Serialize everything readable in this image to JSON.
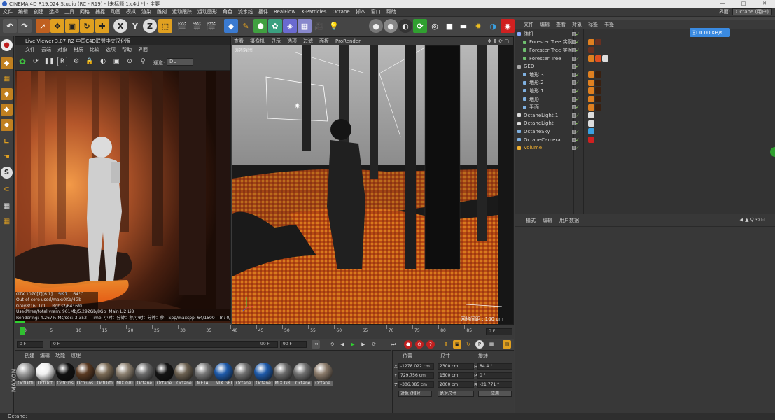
{
  "window": {
    "title": "CINEMA 4D R19.024 Studio (RC - R19) - [未标题 1.c4d *] - 主要"
  },
  "menubar": {
    "items": [
      "文件",
      "编辑",
      "创建",
      "选择",
      "工具",
      "网格",
      "捕捉",
      "动画",
      "模拟",
      "渲染",
      "雕刻",
      "运动跟踪",
      "运动图形",
      "角色",
      "流水线",
      "插件",
      "RealFlow",
      "X-Particles",
      "Octane",
      "脚本",
      "窗口",
      "帮助"
    ],
    "layout_label": "界面:",
    "layout_value": "Octane (用户)"
  },
  "live_viewer": {
    "title": "Live Viewer 3.07-R2 中国C4D联盟中文汉化版",
    "menu": [
      "文件",
      "云端",
      "对象",
      "材质",
      "比较",
      "选项",
      "帮助",
      "界面"
    ],
    "channel_label": "通道:",
    "channel_value": "DL",
    "stats": {
      "gpu": "GTX 1070[T][6.1]",
      "gpu_load": "%97",
      "gpu_temp": "64°C",
      "out_of_core": "Out-of-core used/max:0Kb/4Gb",
      "grey": "Grey8/16: 1/0",
      "rgb": "Rgb32/64: 6/0",
      "vram": "Used/free/total vram: 961Mb/5.292Gb/8Gb",
      "vram_tabs": "Main  Li2  Li8",
      "rendering": "Rendering: 4.267% Ms/sec: 3.352",
      "time": "Time: 小时：分钟：秒/小时：分钟：秒",
      "spp": "Spp/maxspp: 64/1500",
      "tri": "Tri: 0/2.668t"
    }
  },
  "viewport": {
    "menu": [
      "查看",
      "摄像机",
      "显示",
      "选项",
      "过滤",
      "面板",
      "ProRender"
    ],
    "label": "透视视图",
    "grid_spacing": "网格间距 : 100 cm"
  },
  "object_manager": {
    "menu": [
      "文件",
      "编辑",
      "查看",
      "对象",
      "标签",
      "书签"
    ],
    "network_speed": "0.00 KB/s",
    "objects": [
      {
        "name": "随机",
        "indent": 0,
        "color": "#88aaff"
      },
      {
        "name": "Forester Tree 实例.1",
        "indent": 1,
        "color": "#6fbf6f"
      },
      {
        "name": "Forester Tree 实例",
        "indent": 1,
        "color": "#6fbf6f"
      },
      {
        "name": "Forester Tree",
        "indent": 1,
        "color": "#6fbf6f"
      },
      {
        "name": "GEO",
        "indent": 0,
        "color": "#aaaaaa"
      },
      {
        "name": "地形.3",
        "indent": 1,
        "color": "#7fb0e0"
      },
      {
        "name": "地形.2",
        "indent": 1,
        "color": "#7fb0e0"
      },
      {
        "name": "地形.1",
        "indent": 1,
        "color": "#7fb0e0"
      },
      {
        "name": "地形",
        "indent": 1,
        "color": "#7fb0e0"
      },
      {
        "name": "平面",
        "indent": 1,
        "color": "#7fb0e0"
      },
      {
        "name": "OctaneLight.1",
        "indent": 0,
        "color": "#dddddd"
      },
      {
        "name": "OctaneLight",
        "indent": 0,
        "color": "#dddddd"
      },
      {
        "name": "OctaneSky",
        "indent": 0,
        "color": "#7fb0e0"
      },
      {
        "name": "OctaneCamera",
        "indent": 0,
        "color": "#7fb0e0"
      },
      {
        "name": "Volume",
        "indent": 0,
        "color": "#f0b030"
      }
    ]
  },
  "attribute_manager": {
    "menu": [
      "模式",
      "编辑",
      "用户数据"
    ]
  },
  "timeline": {
    "ticks": [
      "0",
      "5",
      "10",
      "15",
      "20",
      "25",
      "30",
      "35",
      "40",
      "45",
      "50",
      "55",
      "60",
      "65",
      "70",
      "75",
      "80",
      "85",
      "90"
    ],
    "current_frame": "0 F",
    "start_field": "0 F",
    "range_start": "0 F",
    "range_end": "90 F",
    "end_field": "90 F"
  },
  "materials": {
    "menu": [
      "创建",
      "编辑",
      "功能",
      "纹理"
    ],
    "items": [
      {
        "label": "OctDiffi",
        "color": "#9a9a9a"
      },
      {
        "label": "OctDiffi",
        "color": "#f0f0f0"
      },
      {
        "label": "OctGlos",
        "color": "#111111"
      },
      {
        "label": "OctGlos",
        "color": "#5a3a22"
      },
      {
        "label": "OctDiffi",
        "color": "#7a6a55"
      },
      {
        "label": "MIX GRI",
        "color": "#8c8070"
      },
      {
        "label": "Octane",
        "color": "#6a6a6a"
      },
      {
        "label": "Octane",
        "color": "#141414"
      },
      {
        "label": "Octane",
        "color": "#6b6050"
      },
      {
        "label": "METAL",
        "color": "#777777"
      },
      {
        "label": "MIX GRI",
        "color": "#1e5aaa"
      },
      {
        "label": "Octane",
        "color": "#707070"
      },
      {
        "label": "Octane",
        "color": "#1e5aaa"
      },
      {
        "label": "MIX GRI",
        "color": "#6a6a6a"
      },
      {
        "label": "Octane",
        "color": "#6f6f6f"
      },
      {
        "label": "Octane",
        "color": "#8a7a6a"
      }
    ]
  },
  "coordinates": {
    "headers": [
      "位置",
      "尺寸",
      "旋转"
    ],
    "x_label": "X",
    "x_pos": "-1278.022 cm",
    "x_size": "2300 cm",
    "h_label": "H",
    "h_rot": "84.4 °",
    "y_label": "Y",
    "y_pos": "729.756 cm",
    "y_size": "1500 cm",
    "p_label": "P",
    "p_rot": "0 °",
    "z_label": "Z",
    "z_pos": "-306.085 cm",
    "z_size": "2000 cm",
    "b_label": "B",
    "b_rot": "-21.771 °",
    "mode": "对象 (相对)",
    "size_mode": "绝对尺寸",
    "apply": "应用"
  },
  "status": {
    "text": "Octane:"
  }
}
